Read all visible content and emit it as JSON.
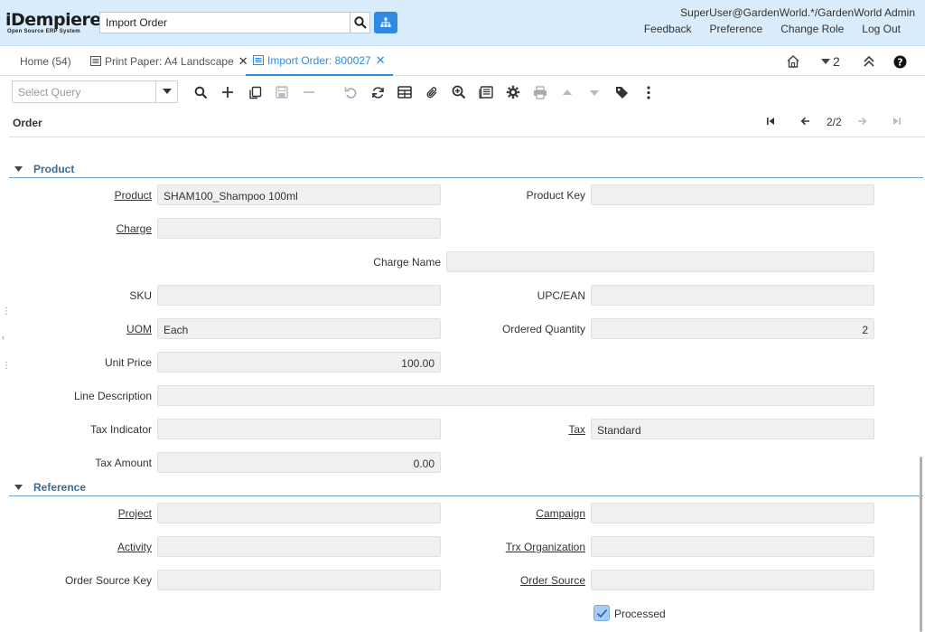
{
  "header": {
    "logo_main": "iDempiere",
    "logo_sub": "Open Source ERP System",
    "search_value": "Import Order",
    "user": "SuperUser@GardenWorld.*/GardenWorld Admin",
    "links": [
      "Feedback",
      "Preference",
      "Change Role",
      "Log Out"
    ]
  },
  "tabs": [
    {
      "label": "Home (54)",
      "icon": "none",
      "active": false
    },
    {
      "label": "Print Paper: A4 Landscape",
      "icon": "window-icon",
      "active": false
    },
    {
      "label": "Import Order: 800027",
      "icon": "window-icon",
      "active": true
    }
  ],
  "tab_tools": {
    "window_count": "2"
  },
  "toolbar": {
    "query_placeholder": "Select Query",
    "icons": [
      "search-icon",
      "new-record-icon",
      "copy-icon",
      "save-icon",
      "delete-icon",
      "undo-icon",
      "refresh-icon",
      "grid-toggle-icon",
      "attachment-icon",
      "zoom-icon",
      "report-icon",
      "process-gear-icon",
      "print-icon",
      "up-icon",
      "down-icon",
      "tag-icon",
      "more-icon"
    ]
  },
  "record_bar": {
    "title": "Order",
    "count": "2/2"
  },
  "sections": {
    "product": "Product",
    "reference": "Reference"
  },
  "fields": {
    "product": {
      "label": "Product",
      "value": "SHAM100_Shampoo 100ml"
    },
    "product_key": {
      "label": "Product Key",
      "value": ""
    },
    "charge": {
      "label": "Charge",
      "value": ""
    },
    "charge_name": {
      "label": "Charge Name",
      "value": ""
    },
    "sku": {
      "label": "SKU",
      "value": ""
    },
    "upc": {
      "label": "UPC/EAN",
      "value": ""
    },
    "uom": {
      "label": "UOM",
      "value": "Each"
    },
    "ordered_qty": {
      "label": "Ordered Quantity",
      "value": "2"
    },
    "unit_price": {
      "label": "Unit Price",
      "value": "100.00"
    },
    "line_desc": {
      "label": "Line Description",
      "value": ""
    },
    "tax_indicator": {
      "label": "Tax Indicator",
      "value": ""
    },
    "tax": {
      "label": "Tax",
      "value": "Standard"
    },
    "tax_amount": {
      "label": "Tax Amount",
      "value": "0.00"
    },
    "project": {
      "label": "Project",
      "value": ""
    },
    "campaign": {
      "label": "Campaign",
      "value": ""
    },
    "activity": {
      "label": "Activity",
      "value": ""
    },
    "trx_org": {
      "label": "Trx Organization",
      "value": ""
    },
    "order_source_key": {
      "label": "Order Source Key",
      "value": ""
    },
    "order_source": {
      "label": "Order Source",
      "value": ""
    },
    "processed": {
      "label": "Processed",
      "checked": true
    }
  },
  "colors": {
    "header_bg": "#d9ecfb",
    "accent": "#2f8ae5",
    "section_text": "#3d6c94"
  }
}
